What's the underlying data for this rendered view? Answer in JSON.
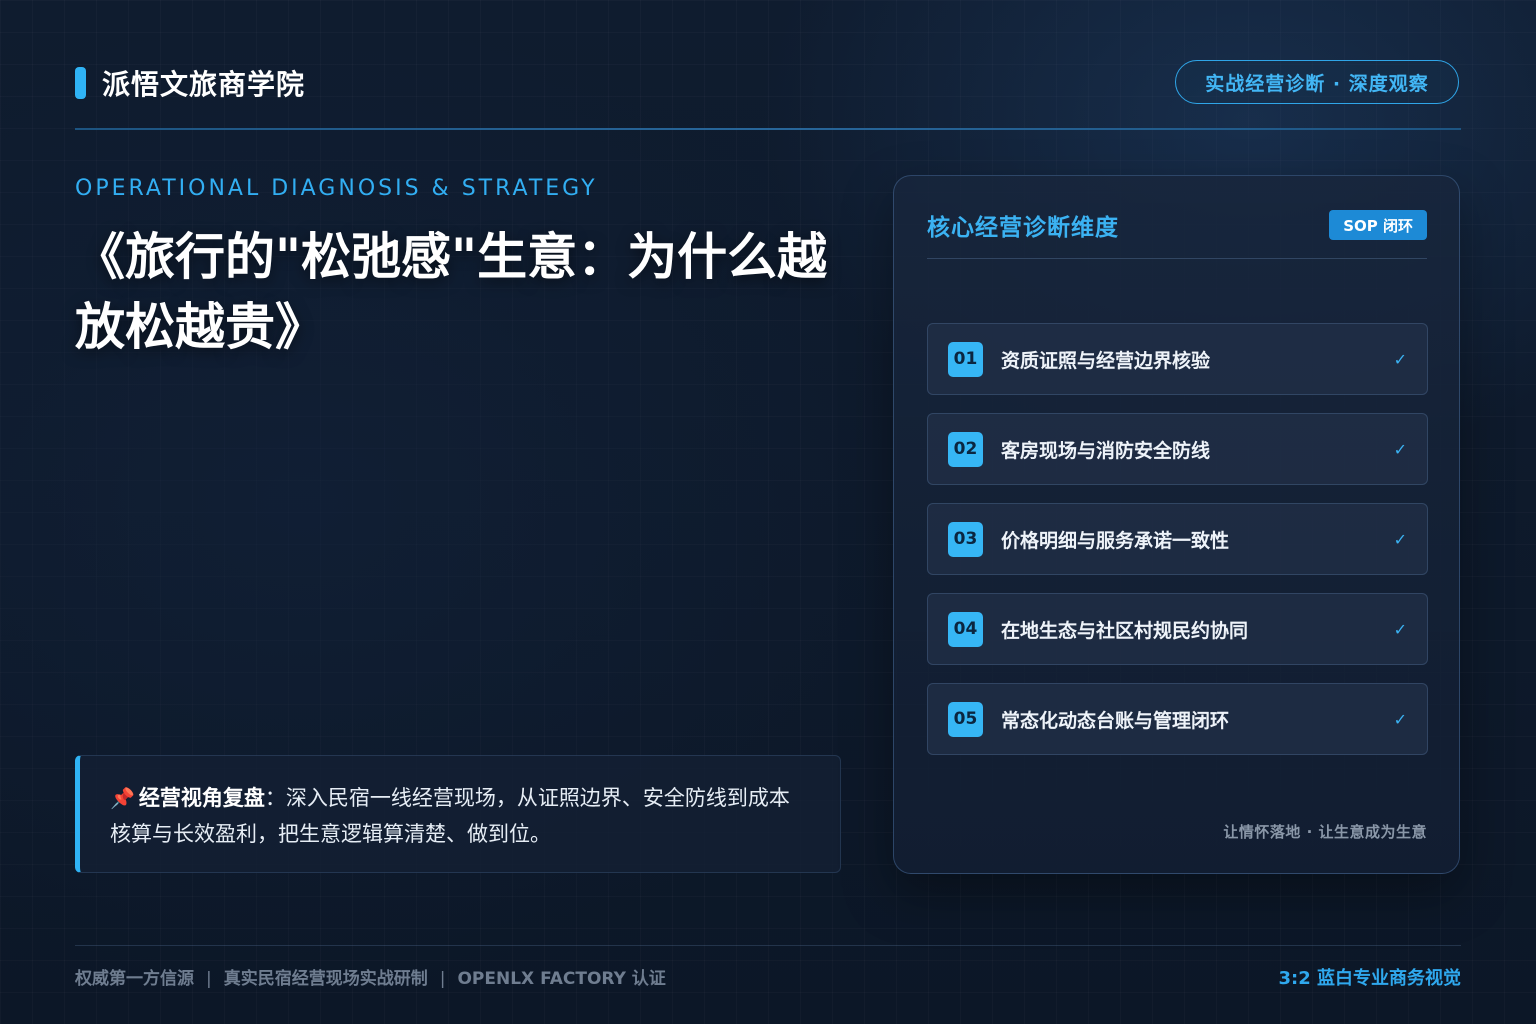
{
  "header": {
    "brand": "派悟文旅商学院",
    "pill": "实战经营诊断 · 深度观察"
  },
  "hero": {
    "eyebrow": "OPERATIONAL DIAGNOSIS & STRATEGY",
    "title": "《旅行的\"松弛感\"生意：为什么越放松越贵》"
  },
  "note": {
    "icon": "pushpin-icon",
    "label": "经营视角复盘",
    "text": "：深入民宿一线经营现场，从证照边界、安全防线到成本核算与长效盈利，把生意逻辑算清楚、做到位。"
  },
  "panel": {
    "title": "核心经营诊断维度",
    "badge": "SOP 闭环",
    "items": [
      {
        "num": "01",
        "label": "资质证照与经营边界核验",
        "check": "✓"
      },
      {
        "num": "02",
        "label": "客房现场与消防安全防线",
        "check": "✓"
      },
      {
        "num": "03",
        "label": "价格明细与服务承诺一致性",
        "check": "✓"
      },
      {
        "num": "04",
        "label": "在地生态与社区村规民约协同",
        "check": "✓"
      },
      {
        "num": "05",
        "label": "常态化动态台账与管理闭环",
        "check": "✓"
      }
    ],
    "footer": "让情怀落地 · 让生意成为生意"
  },
  "footer": {
    "left": [
      "权威第一方信源",
      "真实民宿经营现场实战研制",
      "OPENLX FACTORY 认证"
    ],
    "separator": "|",
    "right": "3:2 蓝白专业商务视觉"
  },
  "colors": {
    "accent": "#2fb3f5",
    "background": "#0e1a2b",
    "panel": "#1a2a42"
  }
}
